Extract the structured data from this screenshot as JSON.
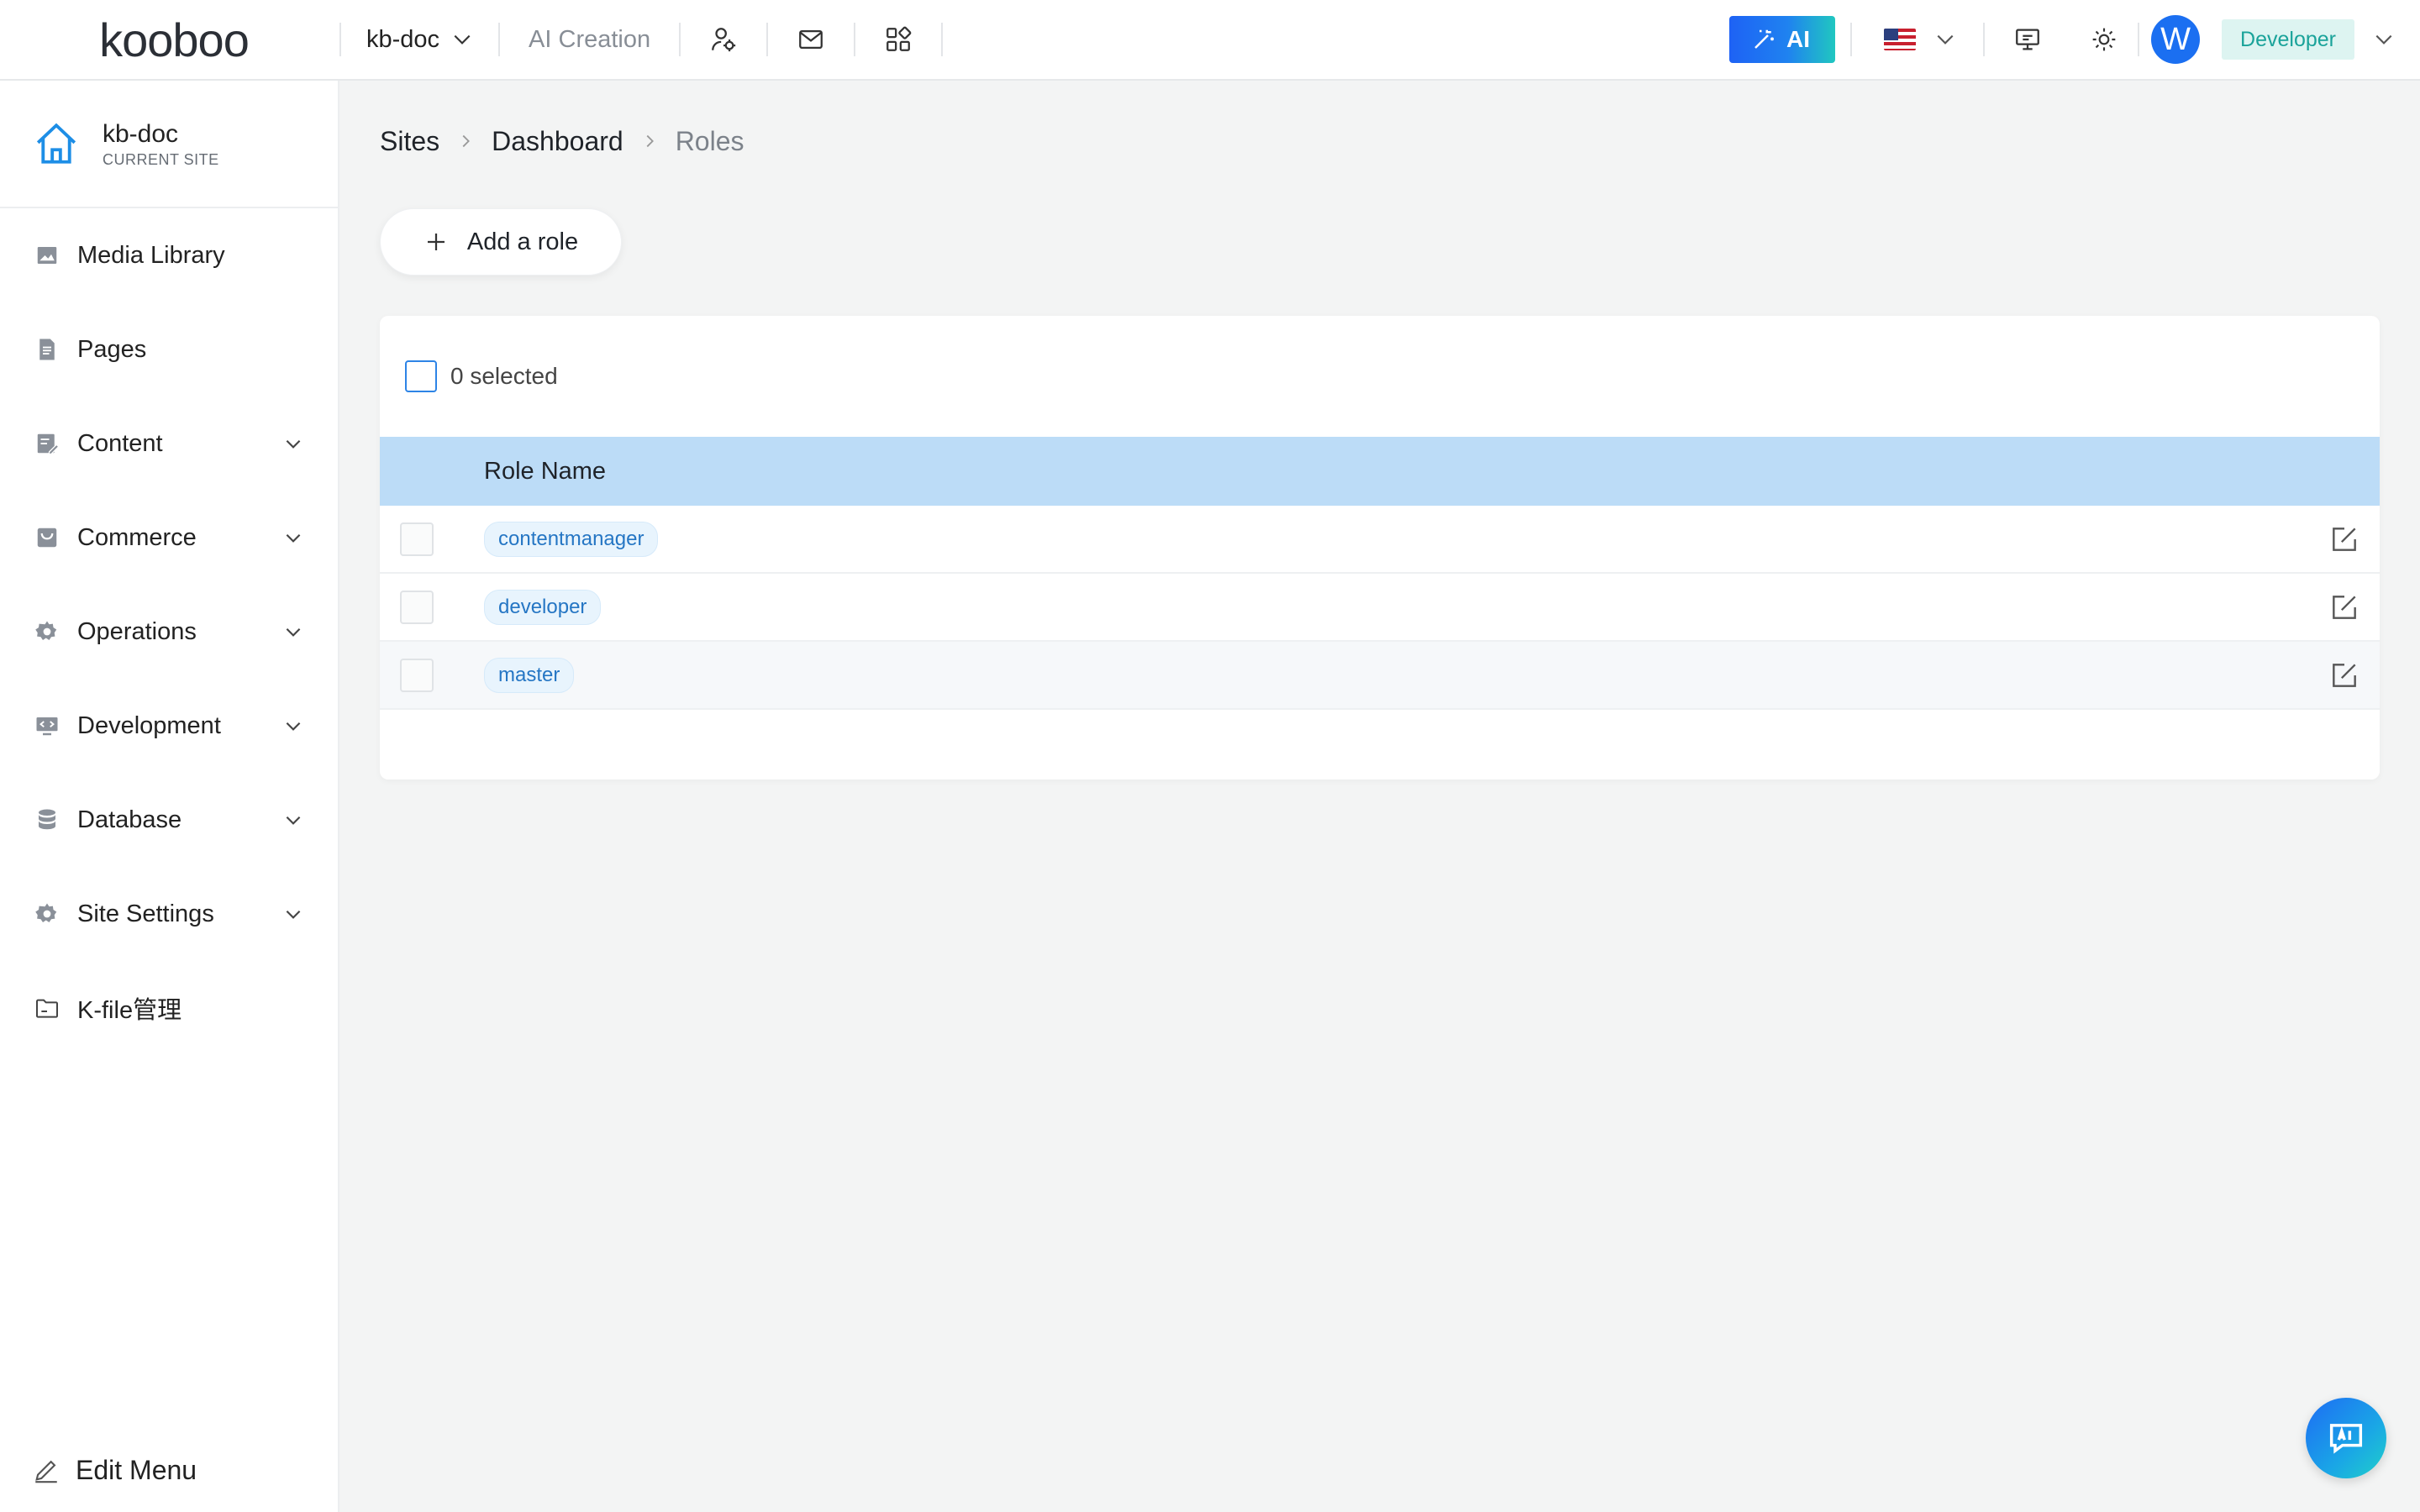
{
  "topbar": {
    "logo_text": "kooboo",
    "site_name": "kb-doc",
    "ai_creation": "AI Creation",
    "ai_button": "AI",
    "avatar_initial": "W",
    "role": "Developer"
  },
  "sidebar": {
    "current_site_name": "kb-doc",
    "current_site_label": "CURRENT SITE",
    "items": [
      {
        "label": "Media Library"
      },
      {
        "label": "Pages"
      },
      {
        "label": "Content"
      },
      {
        "label": "Commerce"
      },
      {
        "label": "Operations"
      },
      {
        "label": "Development"
      },
      {
        "label": "Database"
      },
      {
        "label": "Site Settings"
      },
      {
        "label": "K-file管理"
      }
    ],
    "edit_menu": "Edit Menu"
  },
  "breadcrumb": [
    "Sites",
    "Dashboard",
    "Roles"
  ],
  "add_role_label": "Add a role",
  "table": {
    "selected_text": "0 selected",
    "column_role_name": "Role Name",
    "rows": [
      {
        "name": "contentmanager"
      },
      {
        "name": "developer"
      },
      {
        "name": "master"
      }
    ]
  },
  "colors": {
    "accent": "#1b6ff1",
    "header_row": "#bcdcf7",
    "role_tag_bg": "#ddf4f1",
    "role_tag_text": "#1aa39a"
  }
}
